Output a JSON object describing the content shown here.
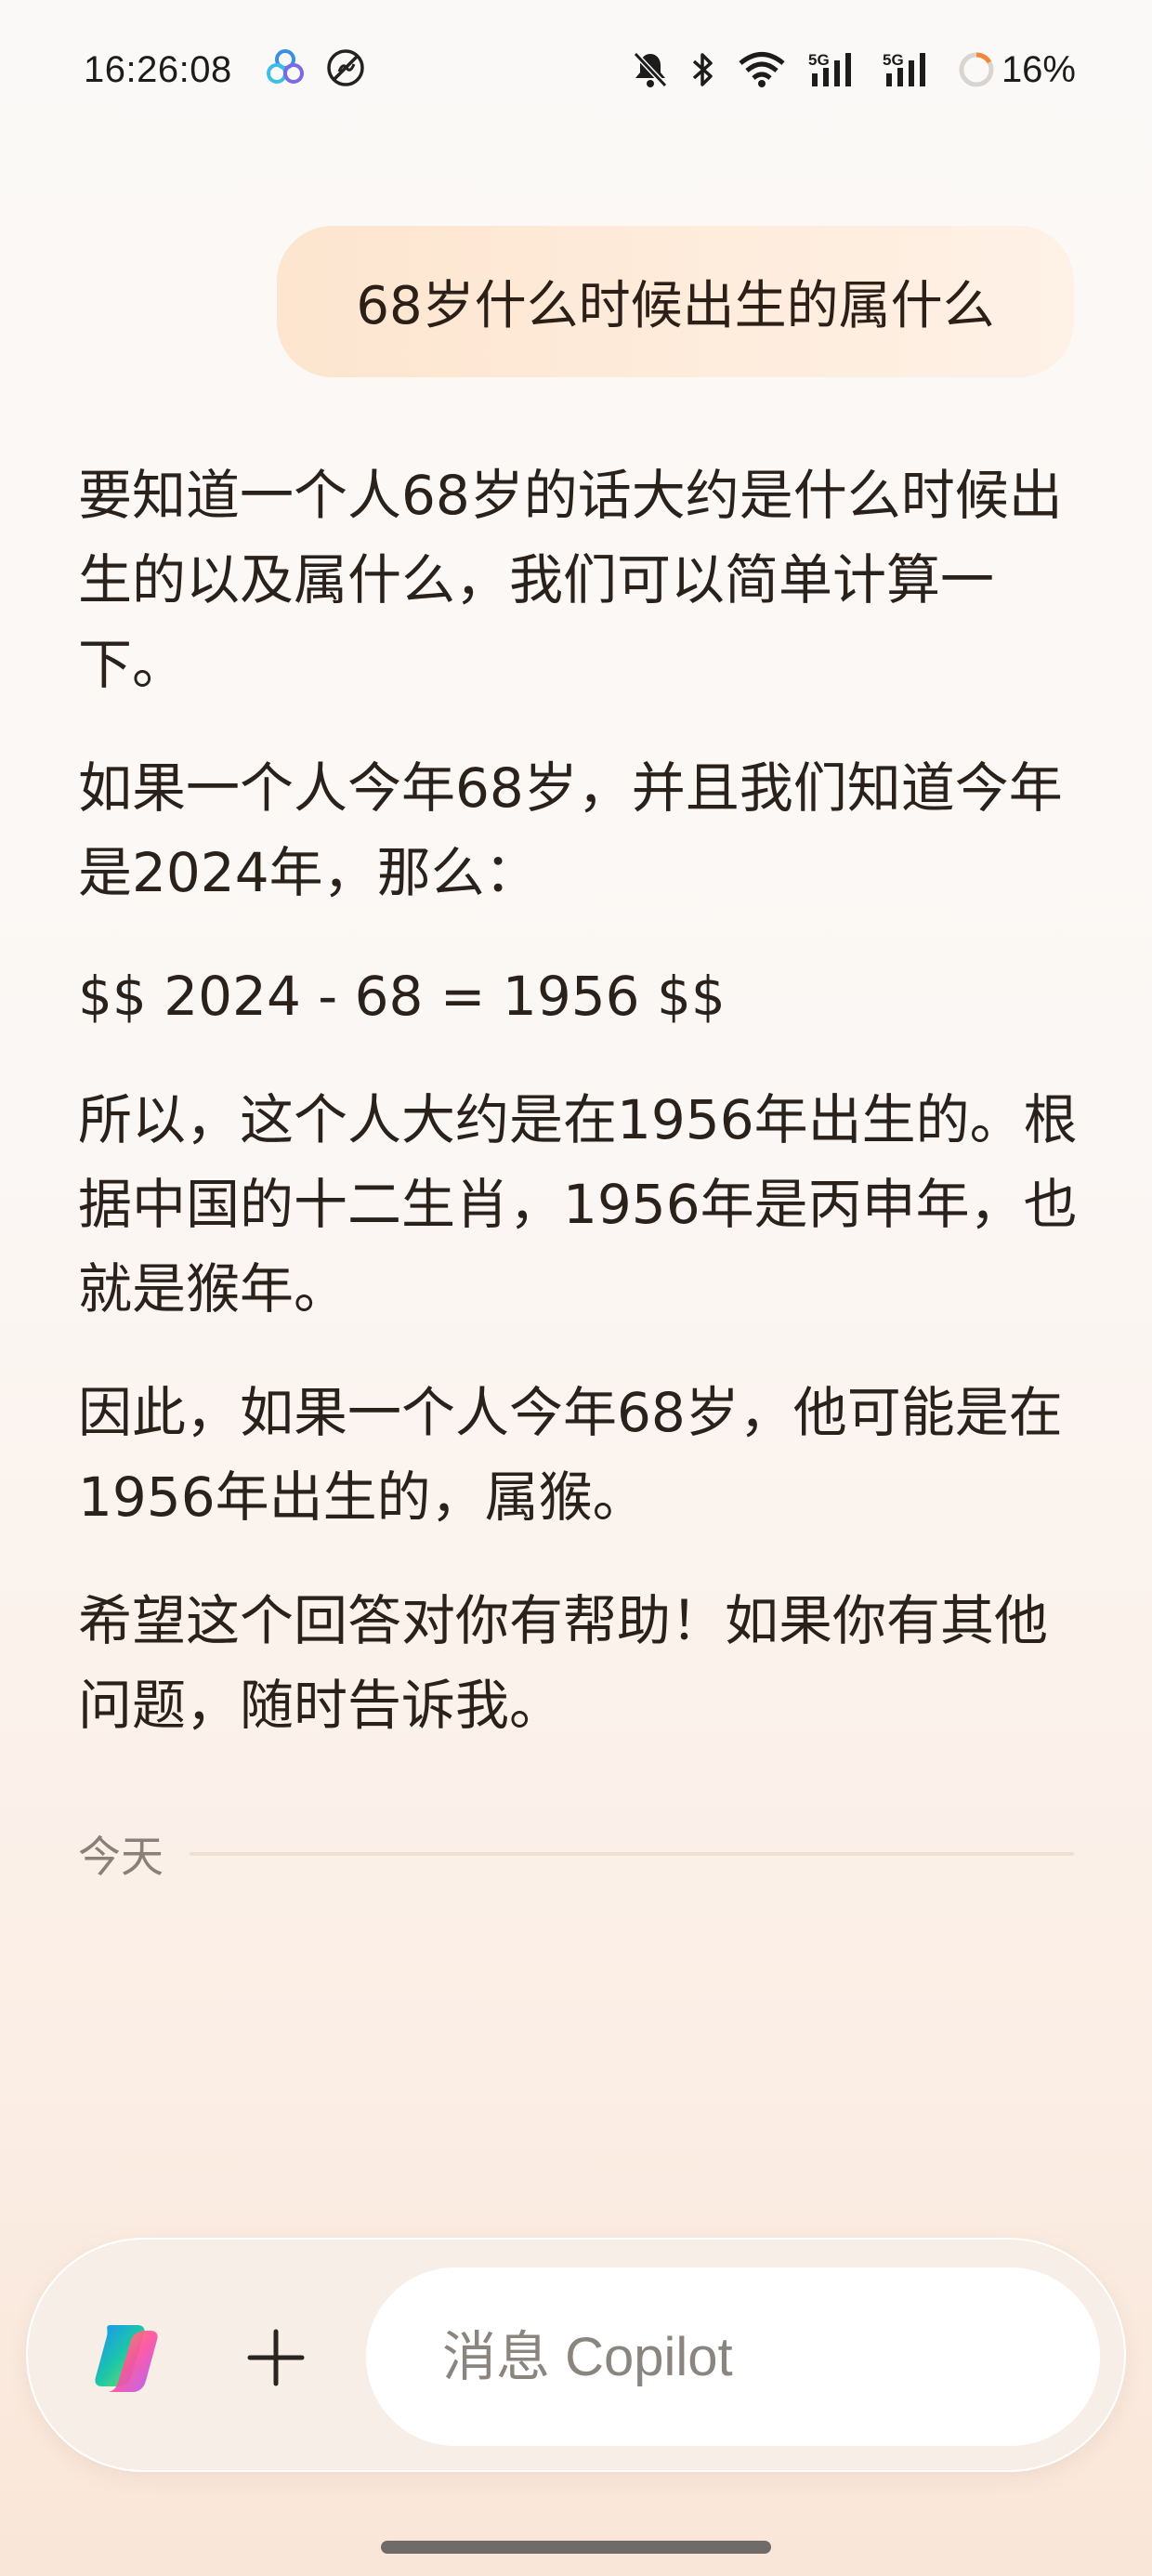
{
  "status_bar": {
    "time": "16:26:08",
    "battery_percent": "16%",
    "icons": [
      "app-icon-petals",
      "app-icon-no-disturb",
      "bell-muted-icon",
      "bluetooth-icon",
      "wifi-icon",
      "signal-5g-icon",
      "signal-5g-icon",
      "battery-ring-icon"
    ]
  },
  "conversation": {
    "user_message": "68岁什么时候出生的属什么",
    "assistant_paragraphs": [
      "要知道一个人68岁的话大约是什么时候出生的以及属什么，我们可以简单计算一下。",
      "如果一个人今年68岁，并且我们知道今年是2024年，那么：",
      "$$ 2024 - 68 = 1956 $$",
      "所以，这个人大约是在1956年出生的。根据中国的十二生肖，1956年是丙申年，也就是猴年。",
      "因此，如果一个人今年68岁，他可能是在1956年出生的，属猴。",
      "希望这个回答对你有帮助！如果你有其他问题，随时告诉我。"
    ],
    "day_divider": "今天"
  },
  "composer": {
    "placeholder": "消息 Copilot",
    "value": ""
  },
  "colors": {
    "user_bubble": "#fde5cf",
    "text": "#2a211b",
    "divider": "#efe1d2",
    "placeholder": "#8b8580"
  }
}
